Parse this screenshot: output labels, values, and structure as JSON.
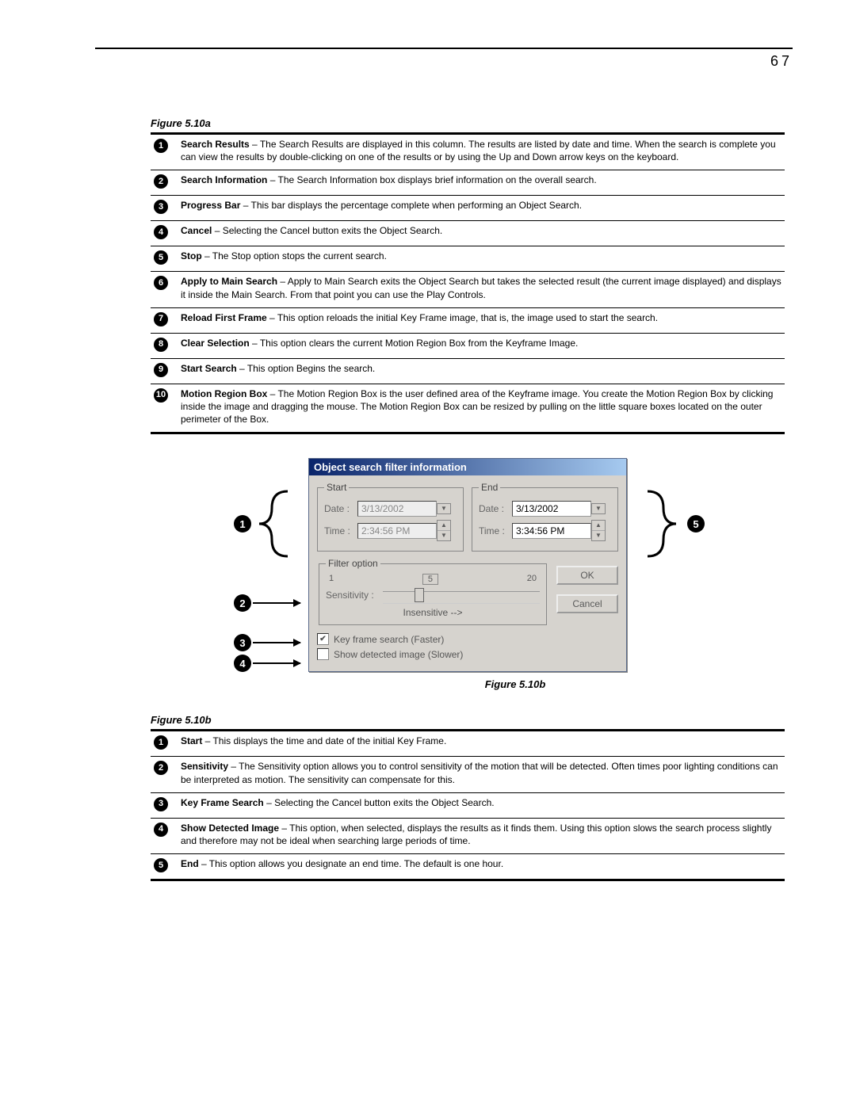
{
  "page_number": "67",
  "figure_a": {
    "label": "Figure 5.10a",
    "items": [
      {
        "n": "1",
        "term": "Search Results",
        "text": " – The Search Results are displayed in this column. The results are listed by date and time. When the search is complete you can view the results by double-clicking on one of the results or by using the Up and Down arrow keys on the keyboard."
      },
      {
        "n": "2",
        "term": "Search Information",
        "text": " – The Search Information box displays brief information on the overall search."
      },
      {
        "n": "3",
        "term": "Progress Bar",
        "text": " – This bar displays the percentage complete when performing an Object Search."
      },
      {
        "n": "4",
        "term": "Cancel",
        "text": " – Selecting the Cancel button exits the Object Search."
      },
      {
        "n": "5",
        "term": "Stop",
        "text": " – The Stop option stops the current search."
      },
      {
        "n": "6",
        "term": "Apply to Main Search",
        "text": " – Apply to Main Search exits the Object Search but takes the selected result (the current image displayed) and displays it inside the Main Search. From that point you can use the Play Controls."
      },
      {
        "n": "7",
        "term": "Reload First Frame",
        "text": " – This option reloads the initial Key Frame image, that is, the image used to start the search."
      },
      {
        "n": "8",
        "term": "Clear Selection",
        "text": " – This option clears the current Motion Region Box from the Keyframe Image."
      },
      {
        "n": "9",
        "term": "Start Search",
        "text": " – This option Begins the search."
      },
      {
        "n": "10",
        "term": "Motion Region Box",
        "text": " – The Motion Region Box is the user defined area of the Keyframe image. You create the Motion Region Box by clicking inside the image and dragging the mouse. The Motion Region Box can be resized by pulling on the little square boxes located on the outer perimeter of the Box."
      }
    ]
  },
  "dialog": {
    "title": "Object search filter information",
    "start_legend": "Start",
    "end_legend": "End",
    "date_label": "Date :",
    "time_label": "Time :",
    "start_date": "3/13/2002",
    "start_time": "2:34:56 PM",
    "end_date": "3/13/2002",
    "end_time": "3:34:56 PM",
    "filter_legend": "Filter option",
    "tick_min": "1",
    "tick_mid": "5",
    "tick_max": "20",
    "sensitivity_label": "Sensitivity :",
    "insensitive_label": "Insensitive -->",
    "ok_label": "OK",
    "cancel_label": "Cancel",
    "keyframe_label": "Key frame search (Faster)",
    "showdetected_label": "Show detected image (Slower)"
  },
  "figure_b_caption": "Figure 5.10b",
  "figure_b": {
    "label": "Figure 5.10b",
    "items": [
      {
        "n": "1",
        "term": "Start",
        "text": " – This displays the time and date of the initial Key Frame."
      },
      {
        "n": "2",
        "term": "Sensitivity",
        "text": " – The Sensitivity option allows you to control sensitivity of the motion that will be detected. Often times poor lighting conditions can be interpreted as motion. The sensitivity can compensate for this."
      },
      {
        "n": "3",
        "term": "Key Frame Search",
        "text": " – Selecting the Cancel button exits the Object Search."
      },
      {
        "n": "4",
        "term": "Show Detected Image",
        "text": " – This option, when selected, displays the results as it finds them. Using this option slows the search process slightly and therefore may not be ideal when searching large periods of time."
      },
      {
        "n": "5",
        "term": "End",
        "text": " – This option allows you designate an end time. The default is one hour."
      }
    ]
  },
  "anno": {
    "a1": "1",
    "a2": "2",
    "a3": "3",
    "a4": "4",
    "a5": "5"
  }
}
